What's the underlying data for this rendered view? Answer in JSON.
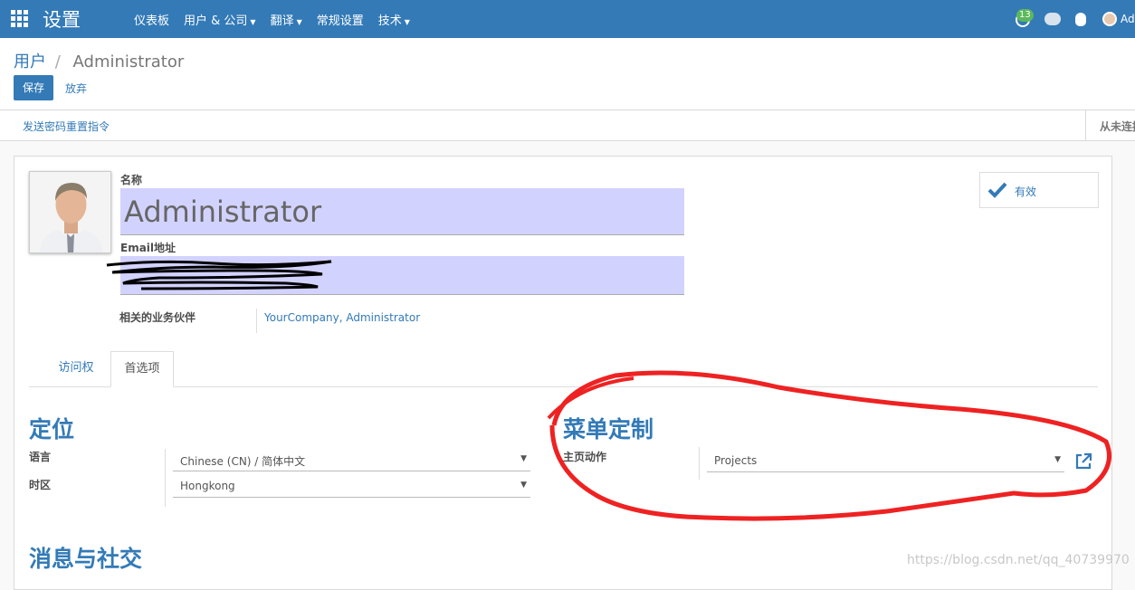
{
  "topbar": {
    "app_title": "设置",
    "menu": [
      {
        "label": "仪表板",
        "dropdown": false
      },
      {
        "label": "用户 & 公司",
        "dropdown": true
      },
      {
        "label": "翻译",
        "dropdown": true
      },
      {
        "label": "常规设置",
        "dropdown": false
      },
      {
        "label": "技术",
        "dropdown": true
      }
    ],
    "notification_count": "13",
    "user_name": "Adr"
  },
  "breadcrumb": {
    "parent": "用户",
    "separator": "/",
    "current": "Administrator"
  },
  "buttons": {
    "save": "保存",
    "discard": "放弃"
  },
  "statusbar": {
    "reset_password": "发送密码重置指令",
    "login_status": "从未连接"
  },
  "form": {
    "name_label": "名称",
    "name_value": "Administrator",
    "email_label": "Email地址",
    "partner_label": "相关的业务伙伴",
    "partner_value": "YourCompany, Administrator",
    "active_label": "有效"
  },
  "tabs": [
    {
      "label": "访问权",
      "active": false
    },
    {
      "label": "首选项",
      "active": true
    }
  ],
  "sections": {
    "localization": {
      "title": "定位",
      "language_label": "语言",
      "language_value": "Chinese (CN) / 简体中文",
      "timezone_label": "时区",
      "timezone_value": "Hongkong"
    },
    "menu_custom": {
      "title": "菜单定制",
      "home_action_label": "主页动作",
      "home_action_value": "Projects"
    },
    "messaging": {
      "title": "消息与社交"
    }
  },
  "watermark": "https://blog.csdn.net/qq_40739970",
  "colors": {
    "primary": "#337ab7",
    "field_bg": "#d2d2ff",
    "annotation": "#ee2222"
  }
}
